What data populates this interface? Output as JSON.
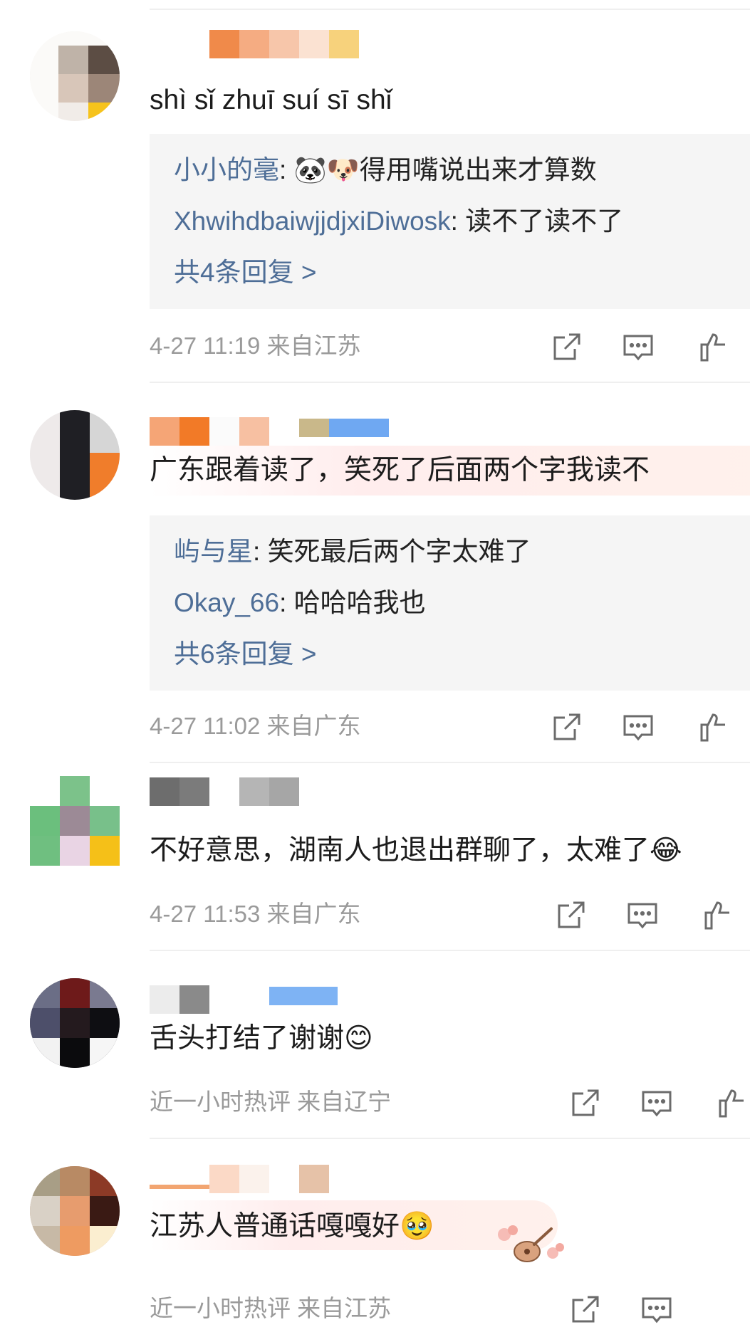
{
  "comments": [
    {
      "text": "shì  sǐ  zhuī  suí  sī  shǐ",
      "replies": [
        {
          "user": "小小的毫",
          "sep": ": ",
          "text": "🐼🐶得用嘴说出来才算数"
        },
        {
          "user": "XhwihdbaiwjjdjxiDiwosk",
          "sep": ": ",
          "text": "读不了读不了"
        }
      ],
      "more": "共4条回复 >",
      "meta": "4-27 11:19  来自江苏"
    },
    {
      "text": "广东跟着读了，笑死了后面两个字我读不",
      "replies": [
        {
          "user": "屿与星",
          "sep": ": ",
          "text": "笑死最后两个字太难了"
        },
        {
          "user": "Okay_66",
          "sep": ": ",
          "text": "哈哈哈我也"
        }
      ],
      "more": "共6条回复 >",
      "meta": "4-27 11:02  来自广东"
    },
    {
      "text": "不好意思，湖南人也退出群聊了，太难了😂",
      "meta": "4-27 11:53  来自广东"
    },
    {
      "text": "舌头打结了谢谢😊",
      "meta": "近一小时热评  来自辽宁"
    },
    {
      "text": "江苏人普通话嘎嘎好🥹",
      "meta": "近一小时热评  来自江苏"
    }
  ],
  "icons": [
    "share-icon",
    "comment-icon",
    "like-icon"
  ],
  "colors": {
    "link": "#4e6e97",
    "meta": "#9a9a9a",
    "reply_bg": "#f5f5f5"
  }
}
